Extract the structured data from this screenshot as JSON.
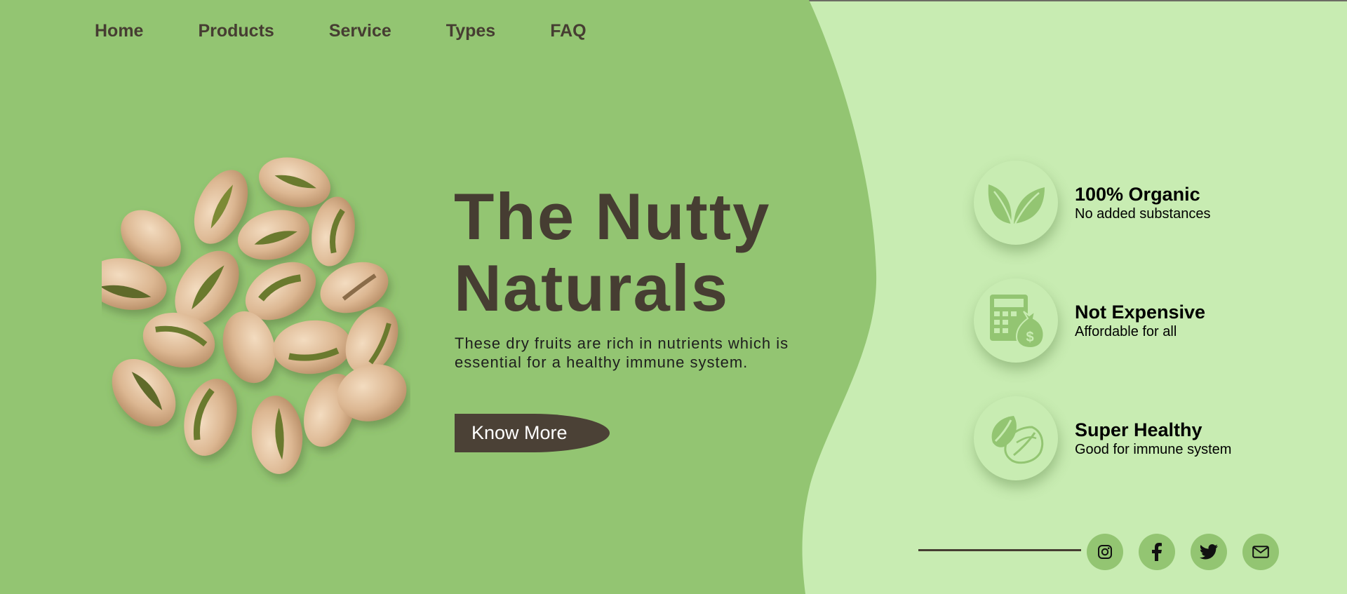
{
  "nav": {
    "items": [
      {
        "label": "Home"
      },
      {
        "label": "Products"
      },
      {
        "label": "Service"
      },
      {
        "label": "Types"
      },
      {
        "label": "FAQ"
      }
    ]
  },
  "hero": {
    "title_line1": "The Nutty",
    "title_line2": "Naturals",
    "description": "These dry fruits are rich in nutrients which is essential for a healthy immune system.",
    "cta_label": "Know More"
  },
  "features": [
    {
      "title": "100% Organic",
      "subtitle": "No added substances",
      "icon": "leaf-icon"
    },
    {
      "title": "Not Expensive",
      "subtitle": "Affordable for all",
      "icon": "calculator-money-bag-icon"
    },
    {
      "title": "Super Healthy",
      "subtitle": "Good for immune system",
      "icon": "nut-icon"
    }
  ],
  "social": [
    {
      "icon": "instagram-icon"
    },
    {
      "icon": "facebook-icon"
    },
    {
      "icon": "twitter-icon"
    },
    {
      "icon": "mail-icon"
    }
  ],
  "colors": {
    "primary_green": "#93c572",
    "light_green": "#c8ecb2",
    "dark_brown": "#463d32",
    "button_brown": "#4b4136"
  },
  "image": {
    "subject": "pistachios-cluster"
  }
}
